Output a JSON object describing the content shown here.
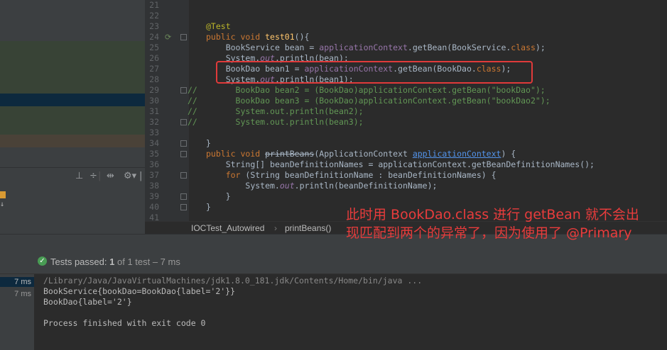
{
  "editor": {
    "lines": [
      {
        "n": "21",
        "html": ""
      },
      {
        "n": "22",
        "html": ""
      },
      {
        "n": "23",
        "html": "<span class='ann'>@Test</span>"
      },
      {
        "n": "24",
        "html": "<span class='kw'>public void </span><span style='color:#ffc66d'>test01</span><span class='pl'>(){</span>",
        "fold": true,
        "mark": true
      },
      {
        "n": "25",
        "html": "    <span class='pl'>BookService bean = </span><span class='fld' style='font-style:normal'>applicationContext</span><span class='pl'>.getBean(BookService.</span><span class='kw'>class</span><span class='pl'>);</span>"
      },
      {
        "n": "26",
        "html": "    <span class='pl'>System.</span><span class='fld'>out</span><span class='pl'>.println(bean);</span>"
      },
      {
        "n": "27",
        "html": "    <span class='pl'>BookDao bean1 = </span><span class='fld' style='font-style:normal'>applicationContext</span><span class='pl'>.getBean(BookDao.</span><span class='kw'>class</span><span class='pl'>);</span>"
      },
      {
        "n": "28",
        "html": "    <span class='pl'>System.</span><span class='fld'>out</span><span class='pl'>.println(bean1);</span>"
      },
      {
        "n": "29",
        "html": "      <span class='cmt'>BookDao bean2 = (BookDao)applicationContext.getBean(\"bookDao\");</span>",
        "cm": true,
        "fold": true
      },
      {
        "n": "30",
        "html": "      <span class='cmt'>BookDao bean3 = (BookDao)applicationContext.getBean(\"bookDao2\");</span>",
        "cm": true
      },
      {
        "n": "31",
        "html": "      <span class='cmt'>System.out.println(bean2);</span>",
        "cm": true
      },
      {
        "n": "32",
        "html": "      <span class='cmt'>System.out.println(bean3);</span>",
        "cm": true,
        "fold": true
      },
      {
        "n": "33",
        "html": ""
      },
      {
        "n": "34",
        "html": "<span class='pl'>}</span>",
        "fold": true
      },
      {
        "n": "35",
        "html": "<span class='kw'>public void </span><span class='strike'>printBeans</span><span class='pl'>(ApplicationContext </span><span class='ul'>applicationContext</span><span class='pl'>) {</span>",
        "fold": true
      },
      {
        "n": "36",
        "html": "    <span class='pl'>String[] beanDefinitionNames = applicationContext.getBeanDefinitionNames();</span>"
      },
      {
        "n": "37",
        "html": "    <span class='kw'>for </span><span class='pl'>(String beanDefinitionName : beanDefinitionNames) {</span>",
        "fold": true
      },
      {
        "n": "38",
        "html": "        <span class='pl'>System.</span><span class='fld'>out</span><span class='pl'>.println(beanDefinitionName);</span>"
      },
      {
        "n": "39",
        "html": "    <span class='pl'>}</span>",
        "fold": true
      },
      {
        "n": "40",
        "html": "<span class='pl'>}</span>",
        "fold": true
      },
      {
        "n": "41",
        "html": ""
      }
    ],
    "comment_marker": "//"
  },
  "breadcrumb": {
    "class_name": "IOCTest_Autowired",
    "method_name": "printBeans()"
  },
  "run": {
    "status_prefix": "Tests passed:",
    "status_count": "1",
    "status_suffix": "of 1 test – 7 ms",
    "times": [
      "7 ms",
      "7 ms"
    ],
    "console_lines": [
      "/Library/Java/JavaVirtualMachines/jdk1.8.0_181.jdk/Contents/Home/bin/java ...",
      "BookService{bookDao=BookDao{label='2'}}",
      "BookDao{label='2'}",
      "",
      "Process finished with exit code 0"
    ]
  },
  "toolbar_icons": [
    "align-icon",
    "sort-icon",
    "expand-icon",
    "gear-icon",
    "hide-icon"
  ],
  "annotation": "此时用 BookDao.class 进行 getBean 就不会出现匹配到两个的异常了，因为使用了 @Primary"
}
